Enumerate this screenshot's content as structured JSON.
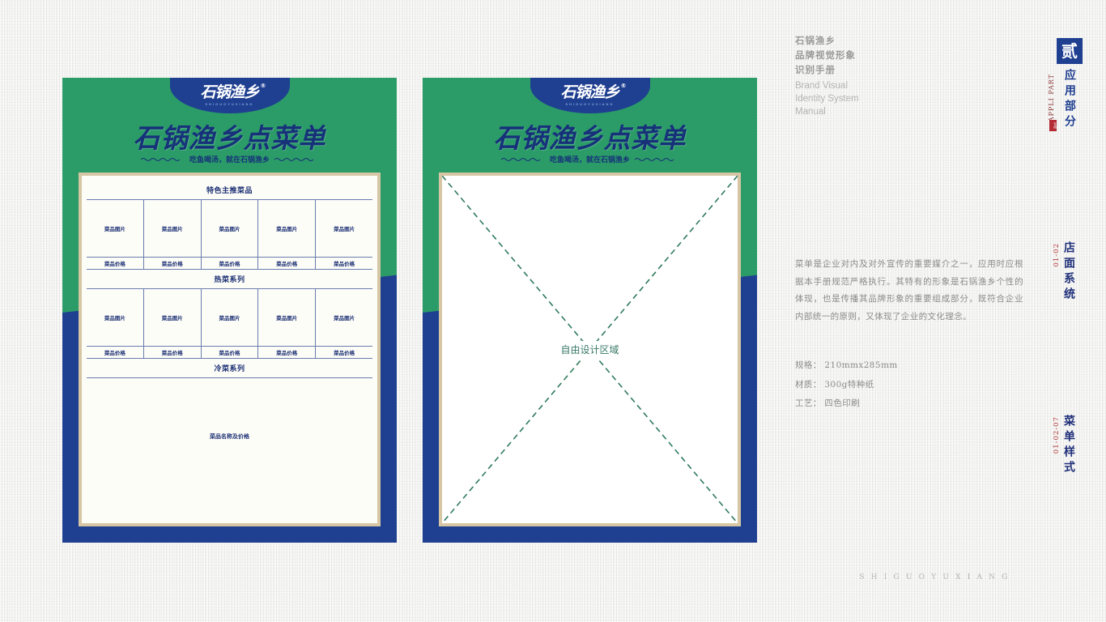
{
  "header": {
    "title_cn_line1": "石锅渔乡",
    "title_cn_line2": "品牌视觉形象",
    "title_cn_line3": "识别手册",
    "title_en_line1": "Brand Visual",
    "title_en_line2": "Identity System",
    "title_en_line3": "Manual"
  },
  "chapter": {
    "number": "贰",
    "name_cn": "应用部分",
    "name_en": "APPLI PART",
    "seal_text": "专用"
  },
  "markers": {
    "system_code": "01-02",
    "system_name": "店面系统",
    "item_code": "01-02-07",
    "item_name": "菜单样式"
  },
  "description": {
    "body": "菜单是企业对内及对外宣传的重要媒介之一，应用时应根据本手册规范严格执行。其特有的形象是石锅渔乡个性的体现，也是传播其品牌形象的重要组成部分，既符合企业内部统一的原则，又体现了企业的文化理念。",
    "spec_size": "规格： 210mmx285mm",
    "spec_material": "材质： 300g特种纸",
    "spec_process": "工艺： 四色印刷"
  },
  "footer": {
    "brand_pinyin": "SHIGUOYUXIANG"
  },
  "menu": {
    "logo_cn": "石锅渔乡",
    "logo_reg": "®",
    "logo_en": "SHIGUOYUXIANG",
    "title": "石锅渔乡点菜单",
    "tagline": "吃鱼喝汤，就在石锅渔乡",
    "section_featured": "特色主推菜品",
    "section_hot": "热菜系列",
    "section_cold": "冷菜系列",
    "cell_image_label": "菜品图片",
    "cell_price_label": "菜品价格",
    "cold_label": "菜品名称及价格",
    "columns": 5
  },
  "free_design": {
    "label": "自由设计区域"
  },
  "colors": {
    "brand_green": "#2b9c68",
    "brand_blue": "#1f3f90",
    "paper_frame": "#d6c6a4",
    "accent_red": "#b43a3a",
    "free_area_teal": "#3a7a68"
  }
}
